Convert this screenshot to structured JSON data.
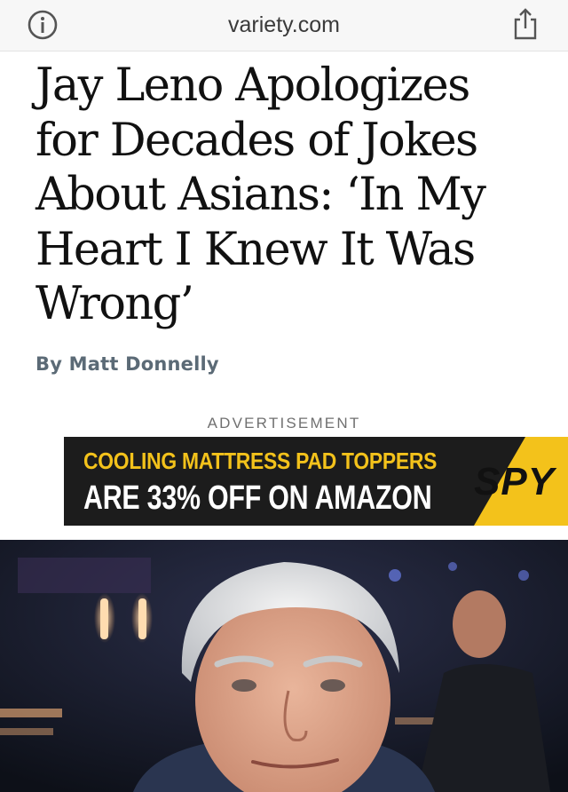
{
  "browser": {
    "url": "variety.com",
    "info_icon": "info-icon",
    "share_icon": "share-icon"
  },
  "article": {
    "headline_lines": [
      "Jay Leno Apologizes",
      "for Decades of Jokes",
      "About Asians: ‘In My",
      "Heart I Knew It Was",
      "Wrong’"
    ],
    "byline": "By Matt Donnelly"
  },
  "ad": {
    "label": "ADVERTISEMENT",
    "line1": "COOLING MATTRESS PAD TOPPERS",
    "line2": "ARE 33% OFF ON AMAZON",
    "brand": "SPY",
    "colors": {
      "background": "#1c1c1c",
      "accent": "#f3c21b",
      "text": "#ffffff"
    }
  },
  "photo": {
    "subject": "portrait-photo"
  }
}
